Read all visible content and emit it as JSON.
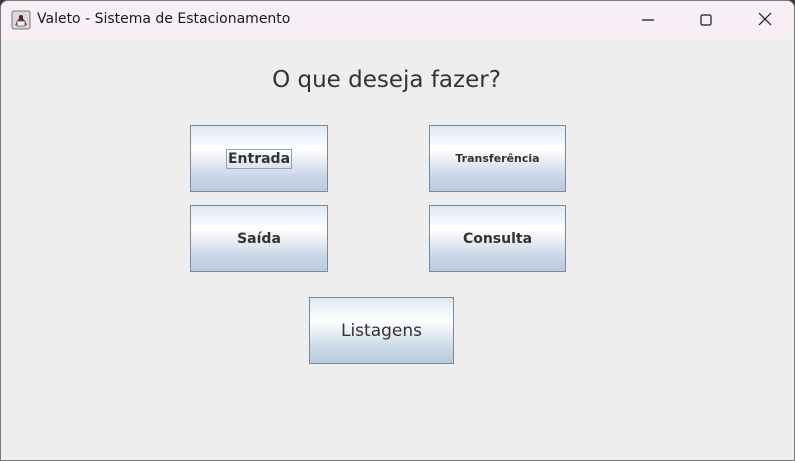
{
  "window": {
    "title": "Valeto - Sistema de Estacionamento",
    "app_icon": "java-coffee-icon",
    "controls": [
      "minimize-icon",
      "maximize-icon",
      "close-icon"
    ]
  },
  "main": {
    "heading": "O que deseja fazer?",
    "buttons": {
      "entrada": "Entrada",
      "transferencia": "Transferência",
      "saida": "Saída",
      "consulta": "Consulta",
      "listagens": "Listagens"
    }
  },
  "colors": {
    "titlebar_bg": "#f8eef5",
    "window_bg": "#eeeeee",
    "button_border": "#7a8a99",
    "text": "#333333"
  }
}
